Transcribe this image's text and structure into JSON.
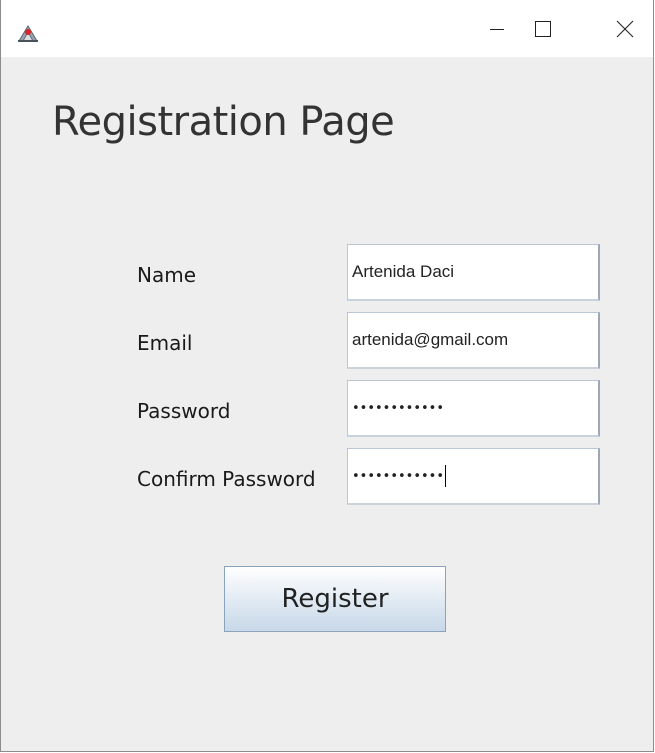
{
  "window": {
    "controls": {
      "minimize_icon": "minimize-icon",
      "maximize_icon": "maximize-icon",
      "close_icon": "close-icon"
    }
  },
  "page": {
    "title": "Registration Page"
  },
  "form": {
    "name": {
      "label": "Name",
      "value": "Artenida Daci"
    },
    "email": {
      "label": "Email",
      "value": "artenida@gmail.com"
    },
    "password": {
      "label": "Password",
      "masked": "••••••••••••"
    },
    "confirm_password": {
      "label": "Confirm Password",
      "masked": "••••••••••••"
    }
  },
  "actions": {
    "register_label": "Register"
  }
}
